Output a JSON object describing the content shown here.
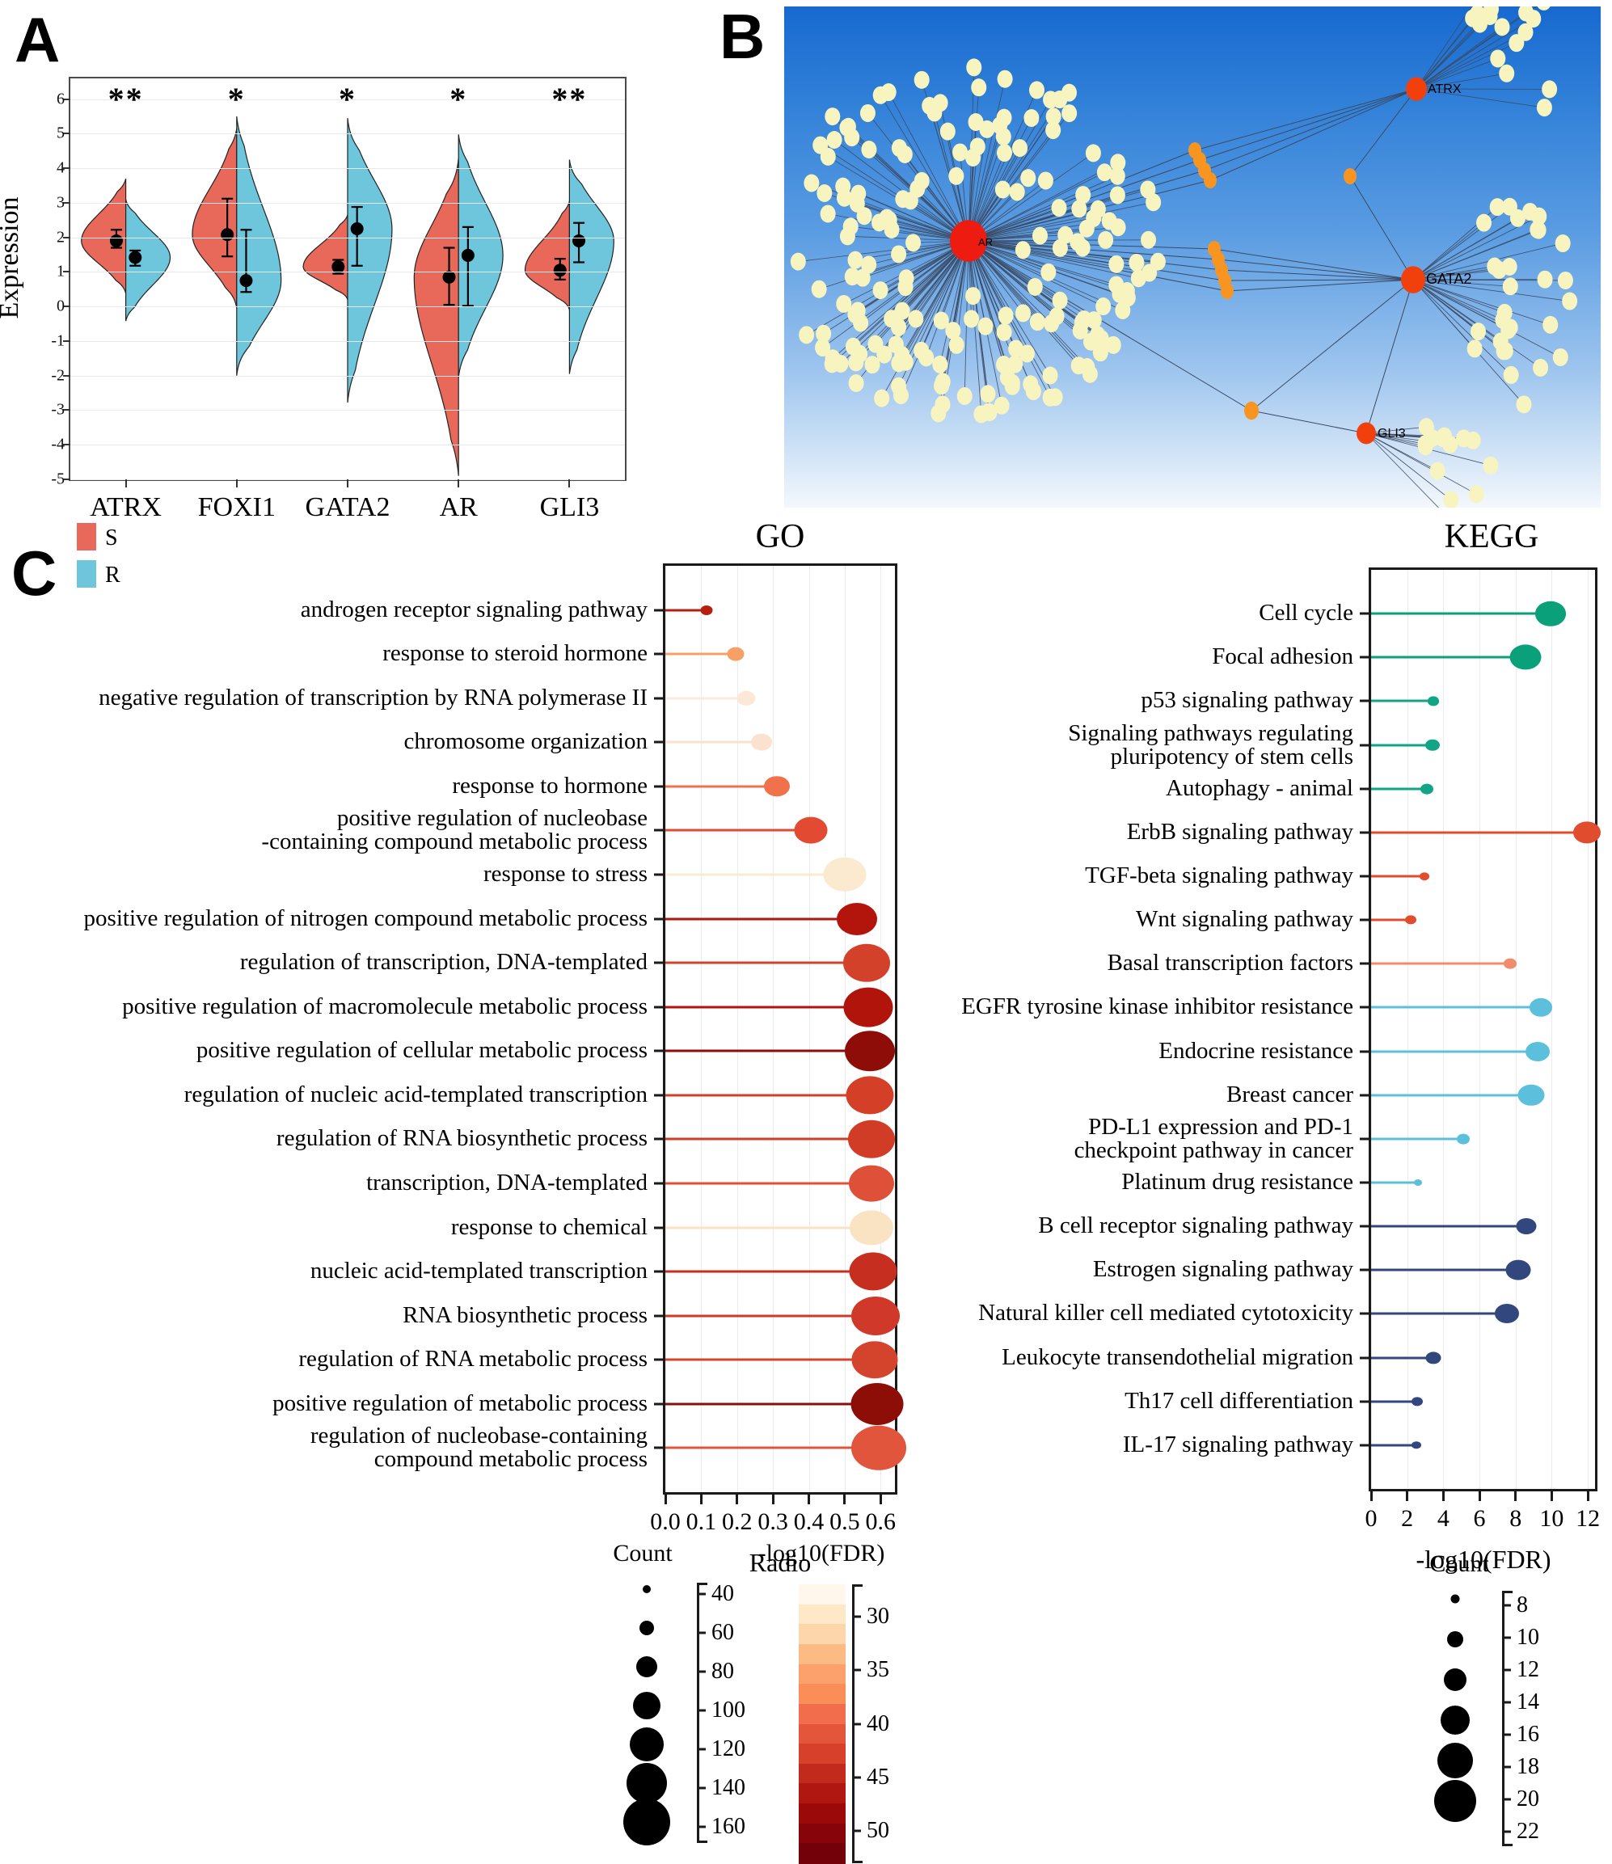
{
  "panels": {
    "a_letter": "A",
    "b_letter": "B",
    "c_letter": "C"
  },
  "panel_a": {
    "ylabel": "Expression",
    "yticks": [
      "6",
      "5",
      "4",
      "3",
      "2",
      "1",
      "0",
      "-1",
      "-2",
      "-3",
      "-4",
      "-5"
    ],
    "genes": [
      "ATRX",
      "FOXI1",
      "GATA2",
      "AR",
      "GLI3"
    ],
    "significance": [
      "**",
      "*",
      "*",
      "*",
      "**"
    ],
    "legend": [
      {
        "label": "S",
        "color": "#e8695a"
      },
      {
        "label": "R",
        "color": "#6ec6dd"
      }
    ],
    "chart_data": {
      "type": "violin",
      "title": "",
      "xlabel": "",
      "ylabel": "Expression",
      "ylim": [
        -5,
        6.6
      ],
      "categories": [
        "ATRX",
        "FOXI1",
        "GATA2",
        "AR",
        "GLI3"
      ],
      "annotations": [
        "**",
        "*",
        "*",
        "*",
        "**"
      ],
      "series": [
        {
          "name": "S",
          "color": "#e8695a",
          "mean": [
            1.9,
            2.08,
            1.15,
            0.85,
            1.05
          ],
          "err_low": [
            1.7,
            1.45,
            0.95,
            0.05,
            0.78
          ],
          "err_high": [
            2.22,
            3.12,
            1.35,
            1.7,
            1.38
          ],
          "min": [
            0.38,
            -0.05,
            0.2,
            -4.9,
            -0.1
          ],
          "max": [
            3.7,
            5.15,
            2.65,
            4.3,
            3.05
          ]
        },
        {
          "name": "R",
          "color": "#6ec6dd",
          "mean": [
            1.42,
            0.75,
            2.25,
            1.48,
            1.9
          ],
          "err_low": [
            1.18,
            0.42,
            1.18,
            0.02,
            1.28
          ],
          "err_high": [
            1.62,
            2.22,
            2.88,
            2.3,
            2.42
          ],
          "min": [
            -0.42,
            -2.0,
            -2.78,
            -2.05,
            -1.95
          ],
          "max": [
            3.1,
            5.5,
            5.45,
            4.98,
            4.25
          ]
        }
      ]
    }
  },
  "panel_b": {
    "hub_nodes": [
      {
        "label": "AR",
        "color": "#ee1b11",
        "size": 46
      },
      {
        "label": "ATRX",
        "color": "#f4600f",
        "size": 26
      },
      {
        "label": "GATA2",
        "color": "#f4400d",
        "size": 28
      },
      {
        "label": "GLI3",
        "color": "#f4600f",
        "size": 22
      }
    ],
    "node_colors": {
      "leaf": "#f7f4c0",
      "mid": "#f89520",
      "hub": "#f2400d",
      "center": "#ee1b11"
    },
    "background": "#2f7fd8"
  },
  "go_panel": {
    "title": "GO",
    "xlabel": "Radio",
    "xticks": [
      "0.0",
      "0.1",
      "0.2",
      "0.3",
      "0.4",
      "0.5",
      "0.6"
    ],
    "size_legend_title": "Count",
    "color_legend_title": "-log10(FDR)",
    "size_legend_values": [
      "40",
      "60",
      "80",
      "100",
      "120",
      "140",
      "160"
    ],
    "color_legend_values": [
      "30",
      "35",
      "40",
      "45",
      "50"
    ],
    "chart_data": {
      "type": "scatter",
      "title": "GO",
      "xlabel": "Radio",
      "ylabel": "",
      "xlim": [
        0.0,
        0.64
      ],
      "grid": true,
      "categories": [
        "androgen receptor signaling pathway",
        "response to steroid hormone",
        "negative regulation of transcription by RNA polymerase II",
        "chromosome organization",
        "response to hormone",
        "positive regulation of nucleobase\n-containing compound metabolic process",
        "response to stress",
        "positive regulation of nitrogen compound metabolic process",
        "regulation of transcription, DNA-templated",
        "positive regulation of macromolecule metabolic process",
        "positive regulation of cellular metabolic process",
        "regulation of nucleic acid-templated transcription",
        "regulation of RNA biosynthetic process",
        "transcription, DNA-templated",
        "response to chemical",
        "nucleic acid-templated transcription",
        "RNA biosynthetic process",
        "regulation of RNA metabolic process",
        "positive regulation of metabolic process",
        "regulation of nucleobase-containing\ncompound metabolic process"
      ],
      "radio": [
        0.115,
        0.195,
        0.225,
        0.268,
        0.312,
        0.405,
        0.5,
        0.535,
        0.56,
        0.565,
        0.57,
        0.57,
        0.575,
        0.575,
        0.575,
        0.58,
        0.585,
        0.583,
        0.59,
        0.595
      ],
      "count": [
        42,
        50,
        52,
        56,
        66,
        82,
        110,
        108,
        122,
        128,
        132,
        128,
        126,
        122,
        118,
        128,
        130,
        124,
        136,
        142
      ],
      "neglog10fdr": [
        50,
        34,
        29,
        30,
        36,
        40,
        28,
        51,
        41,
        49,
        52,
        43,
        44,
        41,
        29,
        45,
        42,
        40,
        52,
        39
      ],
      "colors": [
        "#b91d10",
        "#f7a066",
        "#fbe8d8",
        "#fae2ce",
        "#f0714a",
        "#e34a32",
        "#fbe9d0",
        "#b3150c",
        "#d3412a",
        "#b0140b",
        "#8e0d08",
        "#d43f27",
        "#d13c26",
        "#df5039",
        "#fae3c3",
        "#c62f1f",
        "#d0392a",
        "#d4442c",
        "#8d0d07",
        "#e0553b"
      ],
      "sizes": [
        15,
        21,
        23,
        26,
        32,
        41,
        53,
        50,
        58,
        61,
        62,
        59,
        58,
        56,
        54,
        59,
        60,
        57,
        65,
        68
      ]
    }
  },
  "kegg_panel": {
    "title": "KEGG",
    "xlabel": "-log10(FDR)",
    "xticks": [
      "0",
      "2",
      "4",
      "6",
      "8",
      "10",
      "12"
    ],
    "size_legend_title": "Count",
    "size_legend_values": [
      "8",
      "10",
      "12",
      "14",
      "16",
      "18",
      "20",
      "22"
    ],
    "chart_data": {
      "type": "scatter",
      "title": "KEGG",
      "xlabel": "-log10(FDR)",
      "ylabel": "",
      "xlim": [
        0,
        12.4
      ],
      "grid": true,
      "categories": [
        "Cell cycle",
        "Focal adhesion",
        "p53 signaling pathway",
        "Signaling pathways regulating\npluripotency of stem cells",
        "Autophagy - animal",
        "ErbB signaling pathway",
        "TGF-beta signaling pathway",
        "Wnt signaling pathway",
        "Basal transcription factors",
        "EGFR tyrosine kinase inhibitor resistance",
        "Endocrine resistance",
        "Breast cancer",
        "PD-L1 expression and PD-1\ncheckpoint pathway in cancer",
        "Platinum drug resistance",
        "B cell receptor signaling pathway",
        "Estrogen signaling pathway",
        "Natural killer cell mediated cytotoxicity",
        "Leukocyte transendothelial migration",
        "Th17 cell differentiation",
        "IL-17 signaling pathway"
      ],
      "neglog10fdr": [
        9.95,
        8.55,
        3.45,
        3.4,
        3.1,
        11.95,
        2.95,
        2.2,
        7.7,
        9.4,
        9.2,
        8.85,
        5.1,
        2.6,
        8.6,
        8.15,
        7.5,
        3.45,
        2.55,
        2.5
      ],
      "count": [
        22,
        22,
        9,
        11,
        10,
        20,
        8,
        9,
        10,
        18,
        18,
        20,
        11,
        7,
        15,
        19,
        19,
        12,
        9,
        8
      ],
      "colors": [
        "#0aa07a",
        "#0aa07a",
        "#11a585",
        "#11a585",
        "#11a585",
        "#e24c2e",
        "#e24c2e",
        "#e24c2e",
        "#f08b6c",
        "#5cc0dd",
        "#5cc0dd",
        "#5cc0dd",
        "#5cc0dd",
        "#5cc0dd",
        "#33477f",
        "#33477f",
        "#33477f",
        "#33477f",
        "#33477f",
        "#33477f"
      ],
      "sizes": [
        38,
        39,
        14,
        18,
        16,
        34,
        12,
        14,
        16,
        28,
        30,
        33,
        16,
        10,
        25,
        31,
        30,
        19,
        14,
        12
      ]
    }
  }
}
